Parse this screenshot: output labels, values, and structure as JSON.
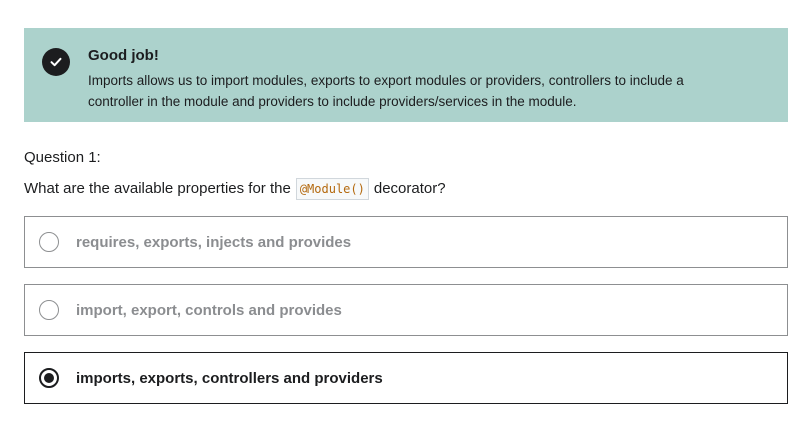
{
  "feedback": {
    "icon": "check-circle-icon",
    "title": "Good job!",
    "message": "Imports allows us to import modules, exports to export modules or providers, controllers to include a controller in the module and providers to include providers/services in the module.",
    "background_color": "#acd2cc"
  },
  "question": {
    "number_label": "Question 1:",
    "text_before": "What are the available properties for the",
    "code": "@Module()",
    "text_after": "decorator?"
  },
  "options": [
    {
      "label": "requires, exports, injects and provides",
      "selected": false
    },
    {
      "label": "import, export, controls and provides",
      "selected": false
    },
    {
      "label": "imports, exports, controllers and providers",
      "selected": true
    }
  ]
}
